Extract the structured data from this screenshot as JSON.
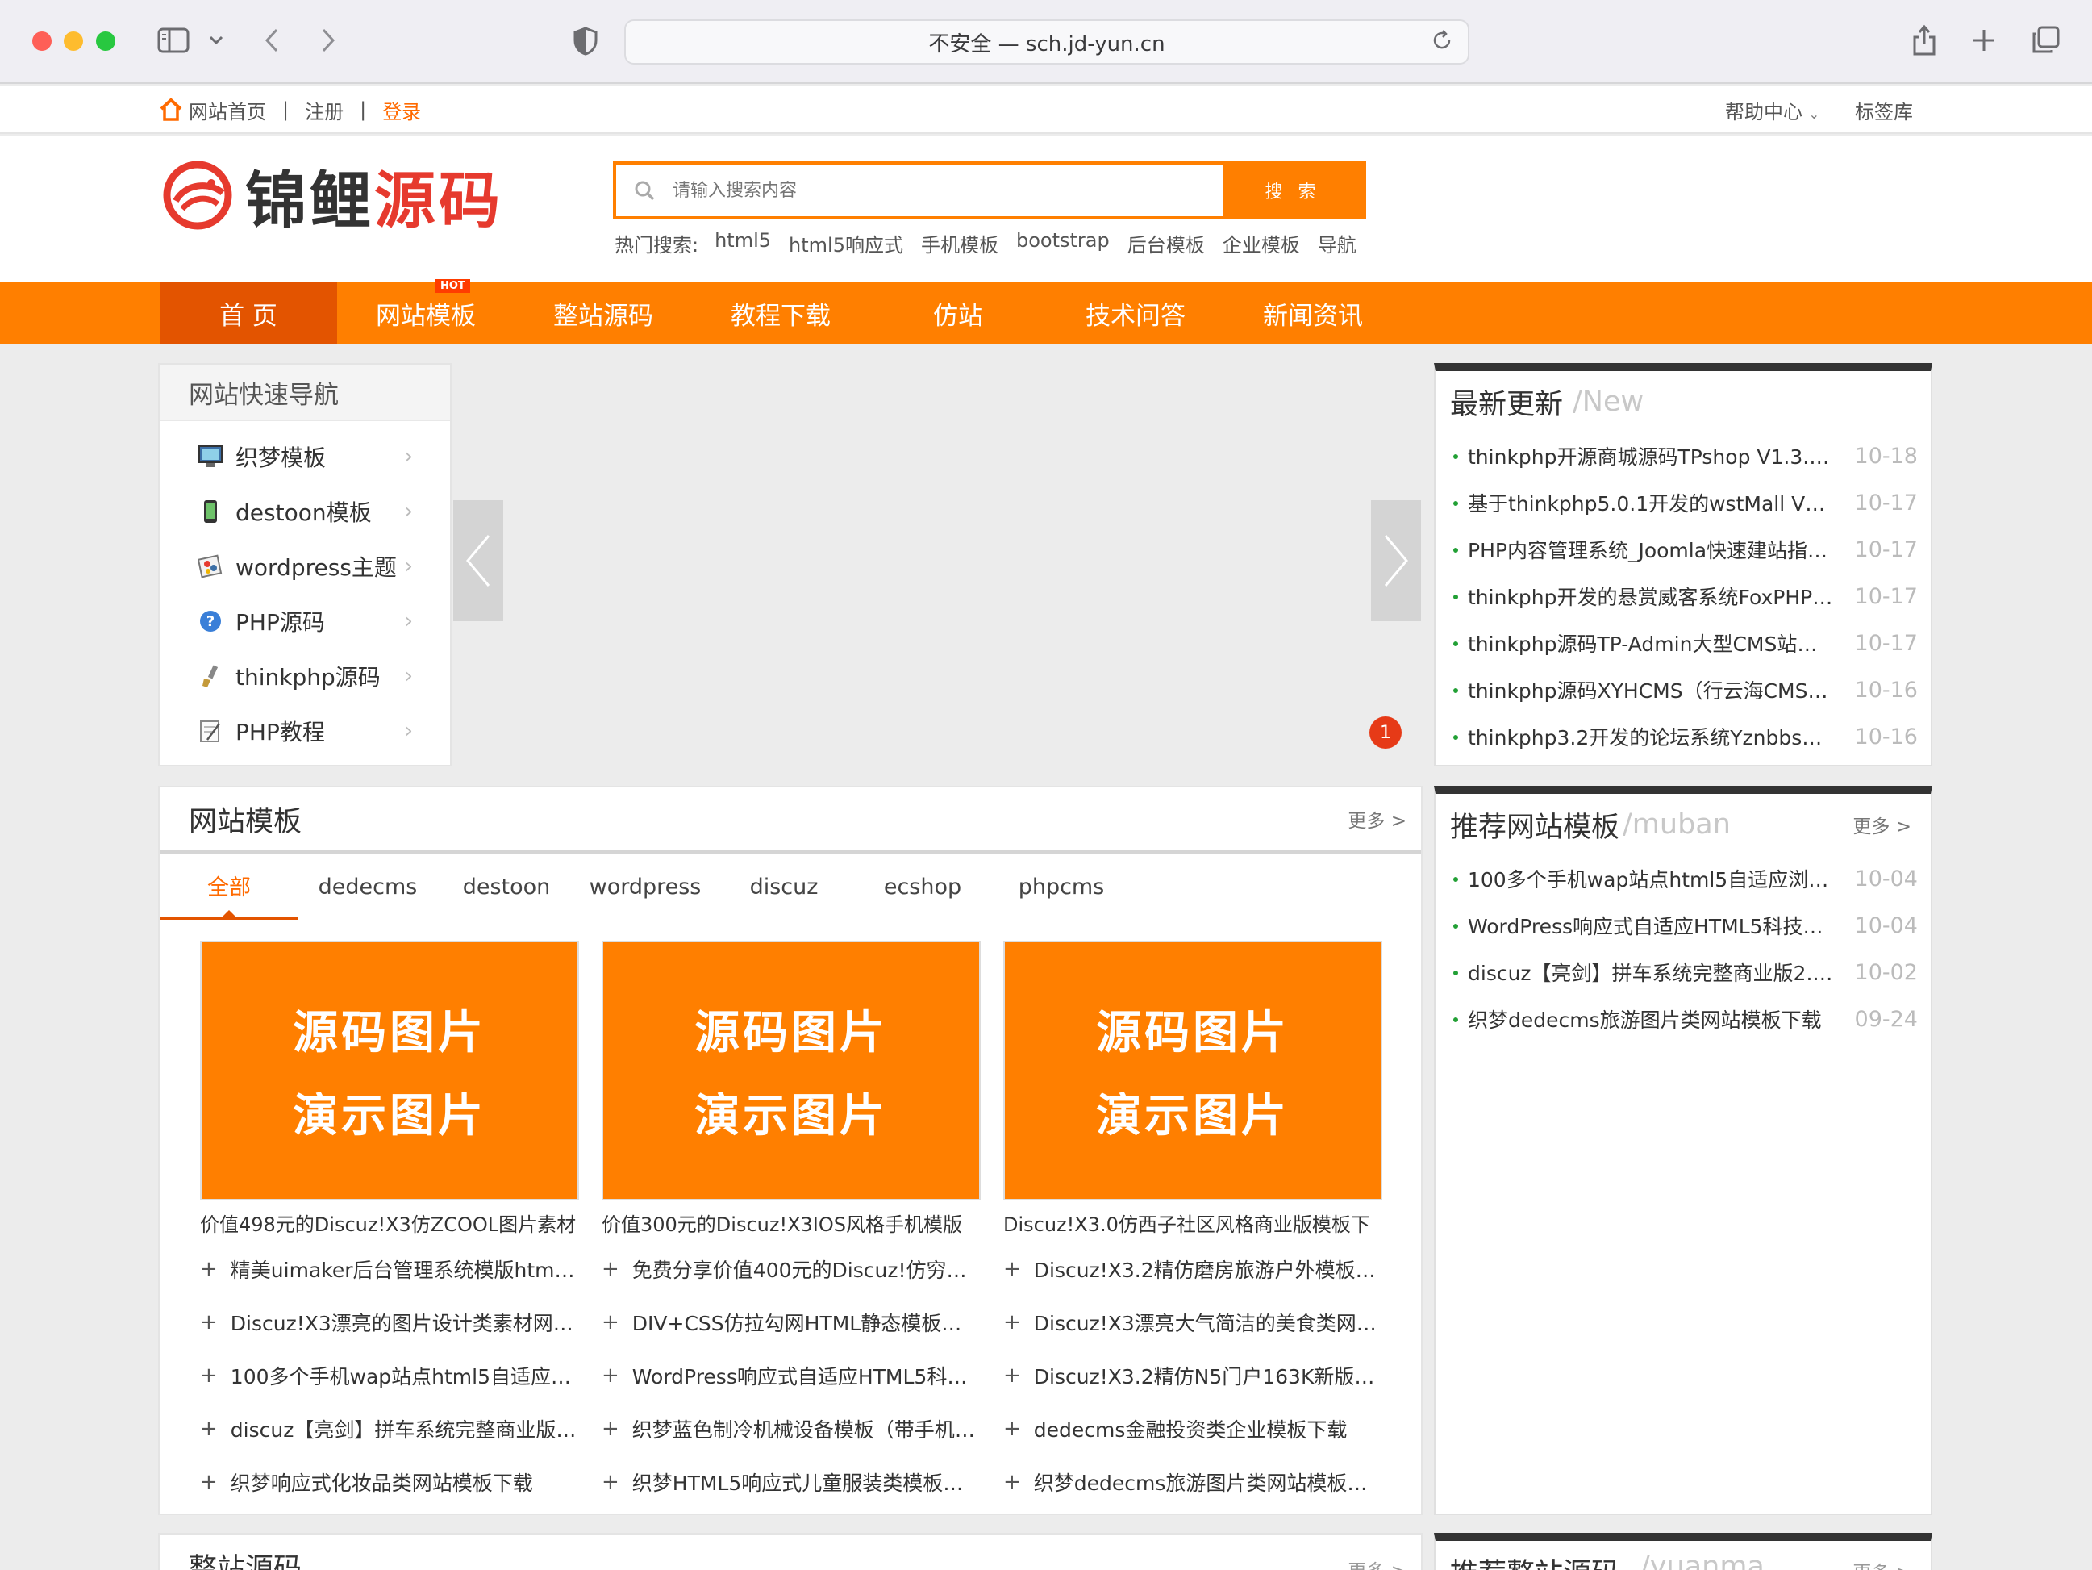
{
  "browser": {
    "address": "不安全 — sch.jd-yun.cn"
  },
  "topbar": {
    "home": "网站首页",
    "register": "注册",
    "login": "登录",
    "help": "帮助中心",
    "tags": "标签库"
  },
  "header": {
    "logo_part1": "锦鲤",
    "logo_part2": "源码",
    "search_placeholder": "请输入搜索内容",
    "search_button": "搜 索",
    "hot_label": "热门搜索:",
    "hot_terms": [
      "html5",
      "html5响应式",
      "手机模板",
      "bootstrap",
      "后台模板",
      "企业模板",
      "导航"
    ]
  },
  "nav": {
    "items": [
      "首 页",
      "网站模板",
      "整站源码",
      "教程下载",
      "仿站",
      "技术问答",
      "新闻资讯"
    ],
    "hot_badge": "HOT"
  },
  "quick_nav": {
    "title": "网站快速导航",
    "items": [
      {
        "label": "织梦模板",
        "icon": "monitor-icon"
      },
      {
        "label": "destoon模板",
        "icon": "phone-icon"
      },
      {
        "label": "wordpress主题",
        "icon": "palette-icon"
      },
      {
        "label": "PHP源码",
        "icon": "help-icon"
      },
      {
        "label": "thinkphp源码",
        "icon": "brush-icon"
      },
      {
        "label": "PHP教程",
        "icon": "notepad-icon"
      }
    ]
  },
  "slider": {
    "page_indicator": "1"
  },
  "latest": {
    "title": "最新更新",
    "subtitle": "/New",
    "items": [
      {
        "title": "thinkphp开源商城源码TPshop V1.3.1…",
        "date": "10-18"
      },
      {
        "title": "基于thinkphp5.0.1开发的wstMall V1.…",
        "date": "10-17"
      },
      {
        "title": "PHP内容管理系统_Joomla快速建站指…",
        "date": "10-17"
      },
      {
        "title": "thinkphp开发的悬赏威客系统FoxPHP…",
        "date": "10-17"
      },
      {
        "title": "thinkphp源码TP-Admin大型CMS站群…",
        "date": "10-17"
      },
      {
        "title": "thinkphp源码XYHCMS（行云海CMS…",
        "date": "10-16"
      },
      {
        "title": "thinkphp3.2开发的论坛系统Yznbbs论…",
        "date": "10-16"
      }
    ]
  },
  "recommend": {
    "title": "推荐网站模板",
    "subtitle": "/muban",
    "more": "更多 >",
    "items": [
      {
        "title": "100多个手机wap站点html5自适应浏…",
        "date": "10-04"
      },
      {
        "title": "WordPress响应式自适应HTML5科技…",
        "date": "10-04"
      },
      {
        "title": "discuz【亮剑】拼车系统完整商业版2.2…",
        "date": "10-02"
      },
      {
        "title": "织梦dedecms旅游图片类网站模板下载",
        "date": "09-24"
      }
    ]
  },
  "templates": {
    "title": "网站模板",
    "more": "更多 >",
    "tabs": [
      "全部",
      "dedecms",
      "destoon",
      "wordpress",
      "discuz",
      "ecshop",
      "phpcms"
    ],
    "placeholder_line1": "源码图片",
    "placeholder_line2": "演示图片",
    "cards": [
      {
        "caption": "价值498元的Discuz!X3仿ZCOOL图片素材"
      },
      {
        "caption": "价值300元的Discuz!X3IOS风格手机模版"
      },
      {
        "caption": "Discuz!X3.0仿西子社区风格商业版模板下"
      }
    ],
    "lists": [
      [
        "精美uimaker后台管理系统模版html+…",
        "Discuz!X3漂亮的图片设计类素材网站…",
        "100多个手机wap站点html5自适应浏…",
        "discuz【亮剑】拼车系统完整商业版2.…",
        "织梦响应式化妆品类网站模板下载"
      ],
      [
        "免费分享价值400元的Discuz!仿穷游…",
        "DIV+CSS仿拉勾网HTML静态模板下载",
        "WordPress响应式自适应HTML5科技…",
        "织梦蓝色制冷机械设备模板（带手机网…",
        "织梦HTML5响应式儿童服装类模板下载"
      ],
      [
        "Discuz!X3.2精仿磨房旅游户外模板下载",
        "Discuz!X3漂亮大气简洁的美食类网站…",
        "Discuz!X3.2精仿N5门户163K新版地…",
        "dedecms金融投资类企业模板下载",
        "织梦dedecms旅游图片类网站模板下载"
      ]
    ]
  },
  "bottom": {
    "main_title": "整站源码",
    "main_more": "更多 >",
    "side_title": "推荐整站源码",
    "side_subtitle": "/yuanma",
    "side_more": "更多 >"
  },
  "colors": {
    "accent": "#ff7f00",
    "nav_active": "#e35400",
    "brand_red": "#e63a2e"
  }
}
